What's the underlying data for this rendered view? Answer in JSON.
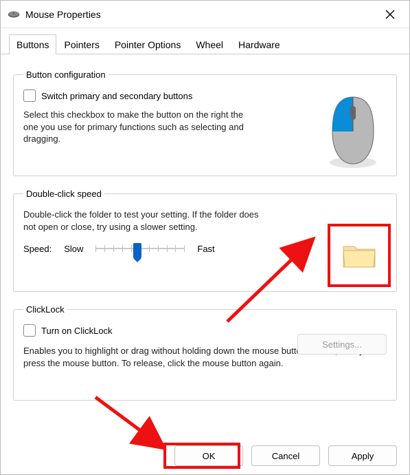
{
  "window": {
    "title": "Mouse Properties"
  },
  "tabs": [
    "Buttons",
    "Pointers",
    "Pointer Options",
    "Wheel",
    "Hardware"
  ],
  "activeTab": "Buttons",
  "group1": {
    "legend": "Button configuration",
    "checkbox_label": "Switch primary and secondary buttons",
    "desc": "Select this checkbox to make the button on the right the one you use for primary functions such as selecting and dragging."
  },
  "group2": {
    "legend": "Double-click speed",
    "desc": "Double-click the folder to test your setting. If the folder does not open or close, try using a slower setting.",
    "speed_label": "Speed:",
    "slow_label": "Slow",
    "fast_label": "Fast"
  },
  "group3": {
    "legend": "ClickLock",
    "checkbox_label": "Turn on ClickLock",
    "settings_label": "Settings...",
    "desc": "Enables you to highlight or drag without holding down the mouse button. To set, briefly press the mouse button. To release, click the mouse button again."
  },
  "buttons": {
    "ok": "OK",
    "cancel": "Cancel",
    "apply": "Apply"
  }
}
